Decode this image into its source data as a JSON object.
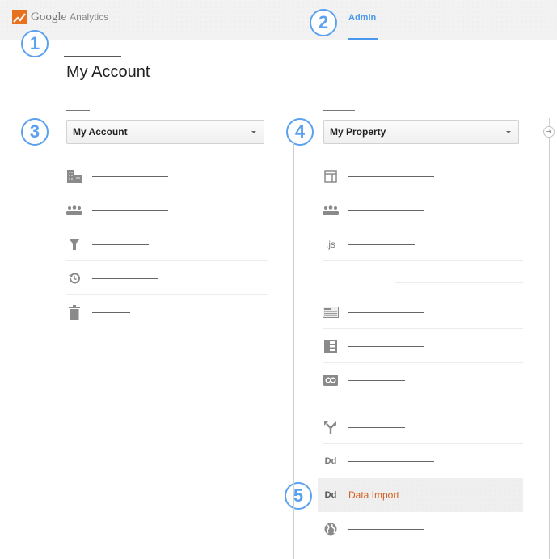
{
  "header": {
    "logo_google": "Google",
    "logo_analytics": "Analytics",
    "nav_items_redacted": [
      {
        "label": ""
      },
      {
        "label": ""
      },
      {
        "label": ""
      }
    ],
    "active_tab": "Admin"
  },
  "callouts": [
    "1",
    "2",
    "3",
    "4",
    "5"
  ],
  "page": {
    "breadcrumb_redacted": "",
    "title": "My Account"
  },
  "account_column": {
    "header_redacted": "",
    "selector_value": "My Account",
    "items": [
      {
        "icon": "building-icon",
        "label": ""
      },
      {
        "icon": "users-icon",
        "label": ""
      },
      {
        "icon": "filter-icon",
        "label": ""
      },
      {
        "icon": "history-icon",
        "label": ""
      },
      {
        "icon": "trash-icon",
        "label": ""
      }
    ]
  },
  "property_column": {
    "header_redacted": "",
    "selector_value": "My Property",
    "items": [
      {
        "icon": "layout-icon",
        "label": ""
      },
      {
        "icon": "users-icon",
        "label": ""
      },
      {
        "icon": "js-icon",
        "icon_text": ".js",
        "label": ""
      }
    ],
    "section_header_redacted": "",
    "section_items": [
      {
        "icon": "content-icon",
        "label": ""
      },
      {
        "icon": "list-detail-icon",
        "label": ""
      },
      {
        "icon": "link-icon",
        "label": ""
      },
      {
        "icon": "fork-icon",
        "label": ""
      },
      {
        "icon": "dd-icon",
        "icon_text": "Dd",
        "label": ""
      },
      {
        "icon": "dd-icon",
        "icon_text": "Dd",
        "label": "Data Import",
        "active": true
      },
      {
        "icon": "globe-icon",
        "label": ""
      }
    ]
  },
  "colors": {
    "accent_blue": "#4a97ee",
    "callout_blue": "#5aa1f0",
    "highlight_orange": "#d35f1f",
    "logo_orange": "#e8711f"
  }
}
